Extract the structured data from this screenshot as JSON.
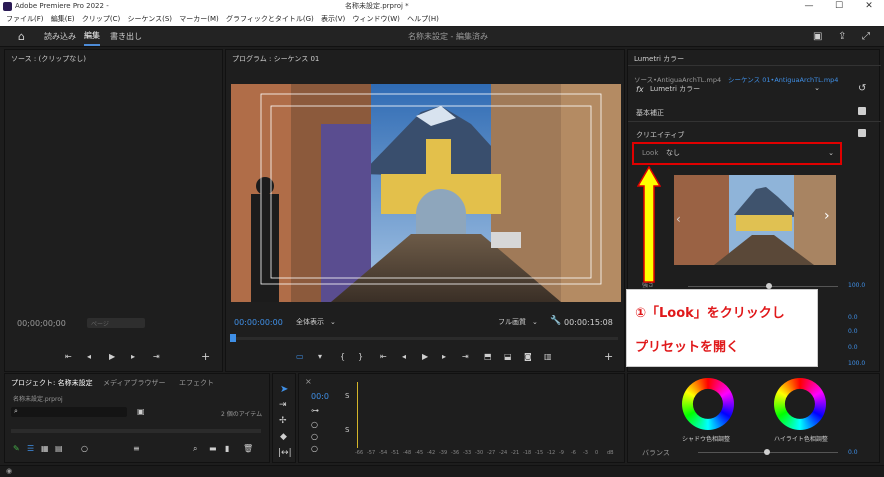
{
  "titlebar": {
    "app_name": "Adobe Premiere Pro 2022 -",
    "project_file": "名称未設定.prproj *",
    "minimize": "—",
    "maximize": "☐",
    "close": "✕"
  },
  "menubar": {
    "items": [
      "ファイル(F)",
      "編集(E)",
      "クリップ(C)",
      "シーケンス(S)",
      "マーカー(M)",
      "グラフィックとタイトル(G)",
      "表示(V)",
      "ウィンドウ(W)",
      "ヘルプ(H)"
    ]
  },
  "workspace": {
    "tabs": [
      "読み込み",
      "編集",
      "書き出し"
    ],
    "active": "編集",
    "center_title": "名称未設定 - 編集済み"
  },
  "source_panel": {
    "title": "ソース : (クリップなし)",
    "timecode": "00;00;00;00",
    "page_label": "ページ"
  },
  "program_panel": {
    "title": "プログラム : シーケンス 01",
    "timecode": "00:00:00:00",
    "fit": "全体表示",
    "quality": "フル画質",
    "duration": "00:00:15:08"
  },
  "lumetri": {
    "title": "Lumetri カラー",
    "source_link": "ソース•AntiguaArchTL.mp4",
    "sequence_link": "シーケンス 01•AntiguaArchTL.mp4",
    "fx_label": "fx",
    "effect_name": "Lumetri カラー",
    "sections": {
      "basic": "基本補正",
      "creative": "クリエイティブ"
    },
    "look_label": "Look",
    "look_value": "なし",
    "values": [
      "100.0",
      "0.0",
      "0.0",
      "0.0",
      "100.0"
    ],
    "shadow_wheel": "シャドウ色相調整",
    "highlight_wheel": "ハイライト色相調整",
    "balance_label": "バランス",
    "balance_value": "0.0",
    "strength_label": "強さ"
  },
  "callout": {
    "line1": "①「Look」をクリックし",
    "line2": "プリセットを開く"
  },
  "project_panel": {
    "tabs": [
      "プロジェクト: 名称未設定",
      "メディアブラウザー",
      "エフェクト"
    ],
    "file": "名称未設定.prproj",
    "item_count": "2 個のアイテム"
  },
  "timeline": {
    "timecode": "00:0",
    "track_a": "S",
    "track_b": "S",
    "ruler": [
      "-66",
      "-57",
      "-54",
      "-51",
      "-48",
      "-45",
      "-42",
      "-39",
      "-36",
      "-33",
      "-30",
      "-27",
      "-24",
      "-21",
      "-18",
      "-15",
      "-12",
      "-9",
      "-6",
      "-3",
      "0",
      "dB"
    ]
  },
  "colors": {
    "accent_blue": "#3f8fe6",
    "annotation_red": "#e00000",
    "arrow_yellow": "#ffff00"
  }
}
